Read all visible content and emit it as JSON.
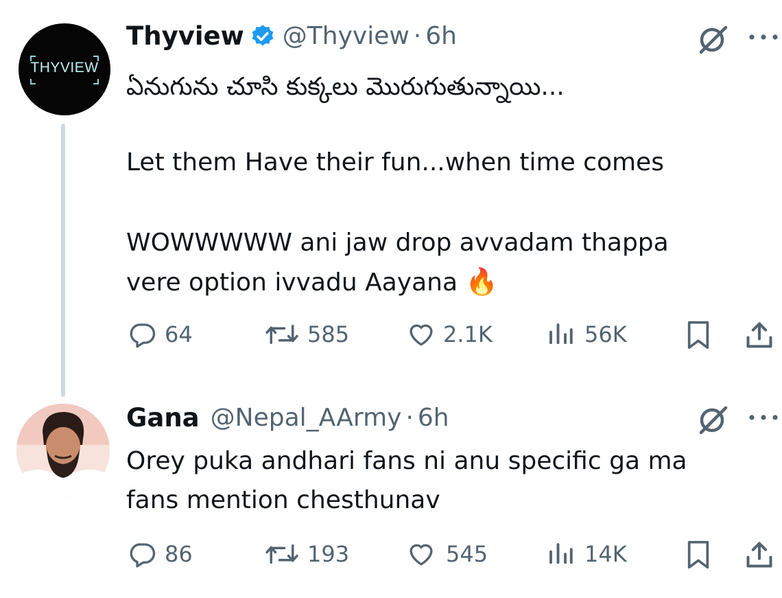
{
  "tweet": {
    "avatar_text": "THYVIEW",
    "name": "Thyview",
    "verified": true,
    "handle": "@Thyview",
    "separator": "·",
    "time": "6h",
    "text_line1": "ఏనుగును చూసి కుక్కలు మొరుగుతున్నాయి...",
    "text_line2": "Let them Have their fun...when time comes",
    "text_line3": "WOWWWWW ani jaw drop avvadam thappa",
    "text_line4": "vere option ivvadu Aayana",
    "emoji": "🔥",
    "metrics": {
      "replies": "64",
      "reposts": "585",
      "likes": "2.1K",
      "views": "56K"
    }
  },
  "reply": {
    "name": "Gana",
    "handle": "@Nepal_AArmy",
    "separator": "·",
    "time": "6h",
    "text_line1": "Orey puka andhari fans ni anu specific ga ma",
    "text_line2": "fans mention chesthunav",
    "metrics": {
      "replies": "86",
      "reposts": "193",
      "likes": "545",
      "views": "14K"
    }
  },
  "colors": {
    "text": "#0f1419",
    "muted": "#536471",
    "verified": "#1d9bf0",
    "thread_line": "#cfd9de"
  }
}
